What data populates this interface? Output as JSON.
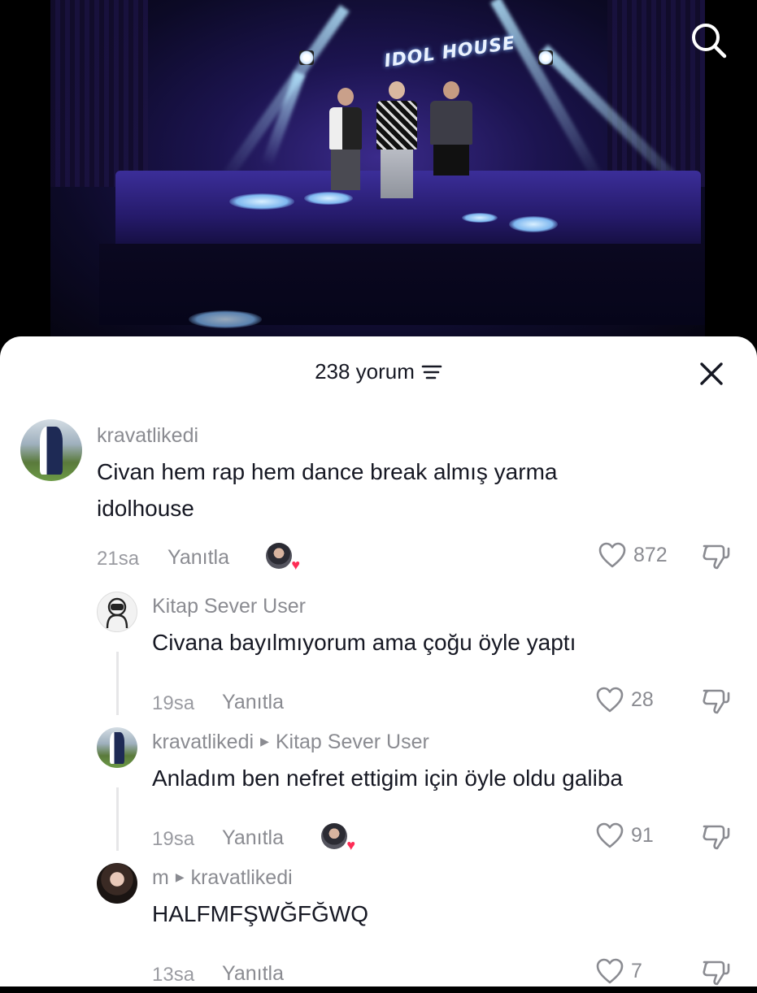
{
  "video": {
    "logo_text": "IDOL HOUSE",
    "search_icon": "search-icon"
  },
  "comments_header": {
    "count_label": "238 yorum",
    "filter_icon": "filter-icon",
    "close_icon": "close-icon"
  },
  "comments": [
    {
      "username": "kravatlikedi",
      "reply_to": "",
      "text_lines": [
        "Civan hem rap hem dance break almış yarma",
        "idolhouse"
      ],
      "time": "21sa",
      "reply_label": "Yanıtla",
      "creator_liked": true,
      "likes": "872"
    },
    {
      "username": "Kitap Sever User",
      "reply_to": "",
      "text_lines": [
        "Civana bayılmıyorum ama çoğu öyle yaptı"
      ],
      "time": "19sa",
      "reply_label": "Yanıtla",
      "creator_liked": false,
      "likes": "28"
    },
    {
      "username": "kravatlikedi",
      "reply_to": "Kitap Sever User",
      "text_lines": [
        "Anladım ben nefret ettigim için öyle oldu galiba"
      ],
      "time": "19sa",
      "reply_label": "Yanıtla",
      "creator_liked": true,
      "likes": "91"
    },
    {
      "username": "m",
      "reply_to": "kravatlikedi",
      "text_lines": [
        "HALFMFŞWĞFĞWQ"
      ],
      "time": "13sa",
      "reply_label": "Yanıtla",
      "creator_liked": false,
      "likes": "7"
    }
  ],
  "colors": {
    "text": "#161823",
    "muted": "#8a8b91",
    "heart": "#fe2c55",
    "sheet": "#ffffff"
  }
}
